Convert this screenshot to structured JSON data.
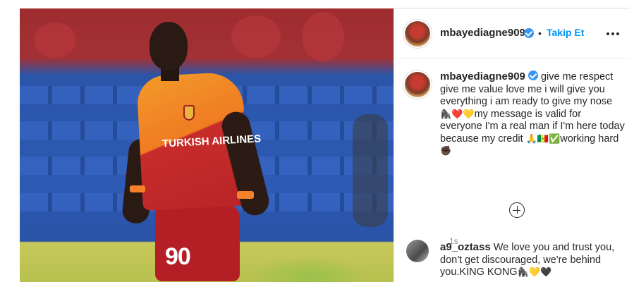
{
  "post": {
    "jersey_number": "90",
    "shirt_sponsor": "TURKISH AIRLINES"
  },
  "header": {
    "username": "mbayediagne909",
    "separator": "•",
    "follow_label": "Takip Et"
  },
  "caption": {
    "username": "mbayediagne909",
    "text_part1": "give me respect give me value love me i will give you everything i am ready to give my nose",
    "emojis1": "🦍❤️💛",
    "text_part2": "my message is valid for everyone I'm a real man if I'm here today because my credit",
    "emojis2": "🙏🇸🇳✅",
    "text_part3": "working hard",
    "emojis3": "✊🏿",
    "time": "1s"
  },
  "comments": [
    {
      "username": "a9_oztass",
      "text": "We love you and trust you, don't get discouraged, we're behind you.KİNG KONG",
      "emojis": "🦍💛🖤"
    }
  ],
  "colors": {
    "link_blue": "#0095f6",
    "verified_blue": "#3897f0",
    "galatasaray_orange": "#f07c22",
    "galatasaray_red": "#c72c2a"
  }
}
